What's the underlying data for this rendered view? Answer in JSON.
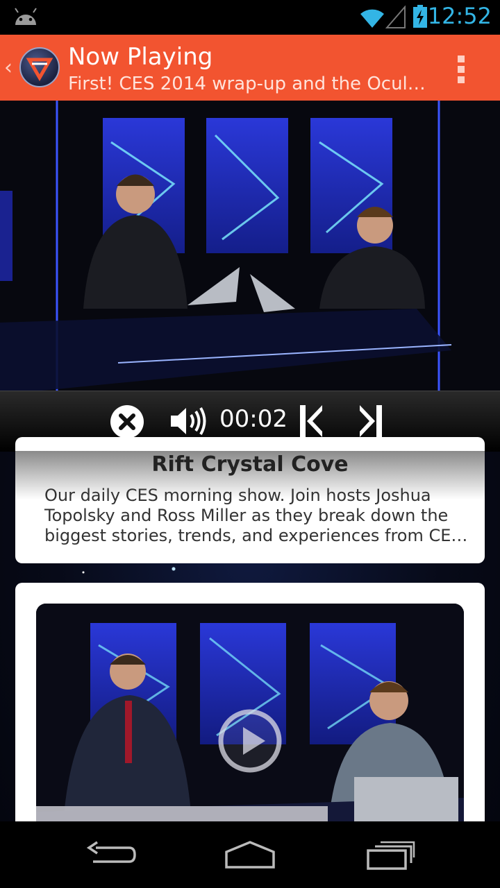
{
  "status_bar": {
    "time": "12:52",
    "icons": [
      "android-icon",
      "wifi-icon",
      "signal-icon",
      "battery-charging-icon"
    ],
    "accent": "#33b5e5"
  },
  "action_bar": {
    "title": "Now Playing",
    "subtitle": "First! CES 2014 wrap-up and the Ocul…",
    "color": "#f25430",
    "icons": [
      "up-caret-icon",
      "app-logo-icon",
      "overflow-menu-icon"
    ]
  },
  "player": {
    "elapsed": "00:02",
    "controls": [
      "close-icon",
      "volume-icon",
      "previous-icon",
      "next-icon"
    ]
  },
  "episode_card": {
    "title": "Rift Crystal Cove",
    "description": "Our daily CES morning show. Join hosts Joshua Topolsky and Ross Miller as they break down the biggest stories, trends, and experiences from CE…"
  },
  "next_card": {
    "thumbnail_icons": [
      "play-icon"
    ]
  },
  "nav_bar": {
    "icons": [
      "back-icon",
      "home-icon",
      "recent-apps-icon"
    ]
  }
}
